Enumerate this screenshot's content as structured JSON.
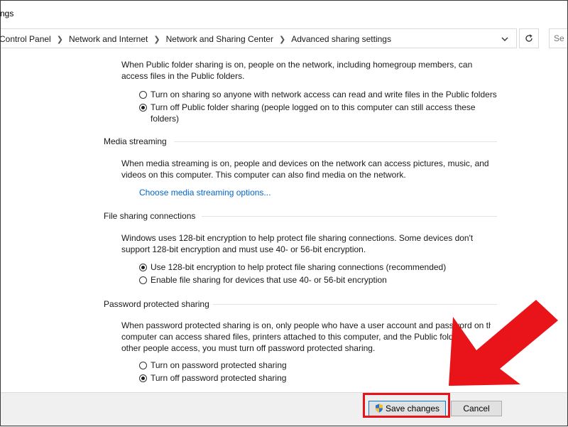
{
  "window": {
    "title": "ngs"
  },
  "address": {
    "crumbs": [
      "Control Panel",
      "Network and Internet",
      "Network and Sharing Center",
      "Advanced sharing settings"
    ],
    "search_placeholder": "Se"
  },
  "public_folder": {
    "description": [
      "When Public folder sharing is on, people on the network, including homegroup members, can",
      "access files in the Public folders."
    ],
    "options": [
      {
        "label": "Turn on sharing so anyone with network access can read and write files in the Public folders",
        "checked": false
      },
      {
        "label_lines": [
          "Turn off Public folder sharing (people logged on to this computer can still access these",
          "folders)"
        ],
        "checked": true
      }
    ]
  },
  "media_streaming": {
    "heading": "Media streaming",
    "description": [
      "When media streaming is on, people and devices on the network can access pictures, music, and",
      "videos on this computer. This computer can also find media on the network."
    ],
    "link": "Choose media streaming options..."
  },
  "file_sharing": {
    "heading": "File sharing connections",
    "description": [
      "Windows uses 128-bit encryption to help protect file sharing connections. Some devices don't",
      "support 128-bit encryption and must use 40- or 56-bit encryption."
    ],
    "options": [
      {
        "label": "Use 128-bit encryption to help protect file sharing connections (recommended)",
        "checked": true
      },
      {
        "label": "Enable file sharing for devices that use 40- or 56-bit encryption",
        "checked": false
      }
    ]
  },
  "password_sharing": {
    "heading": "Password protected sharing",
    "description": [
      "When password protected sharing is on, only people who have a user account and password on th",
      "computer can access shared files, printers attached to this computer, and the Public fold",
      "other people access, you must turn off password protected sharing."
    ],
    "options": [
      {
        "label": "Turn on password protected sharing",
        "checked": false
      },
      {
        "label": "Turn off password protected sharing",
        "checked": true
      }
    ]
  },
  "footer": {
    "save_label": "Save changes",
    "cancel_label": "Cancel"
  },
  "colors": {
    "annotation_red": "#e8141a",
    "link_blue": "#0066cc"
  }
}
